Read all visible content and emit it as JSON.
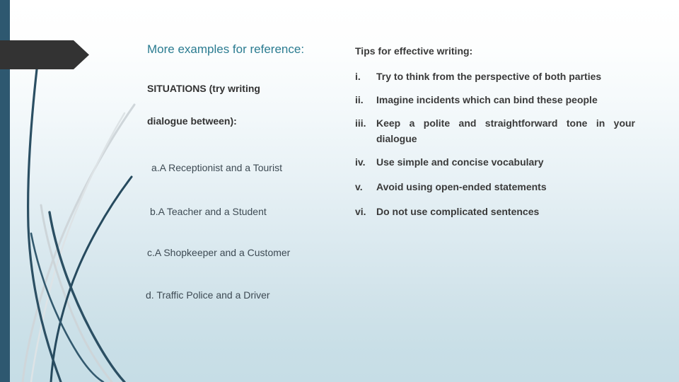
{
  "slide": {
    "background_top_color": "#ffffff",
    "background_bottom_color": "#c6dde6",
    "edge_stripe_color": "#2e5870",
    "banner_color": "#333333",
    "accent_teal": "#2b7c91",
    "body_text_color": "#3a3a3a"
  },
  "left": {
    "heading": "More examples for reference:",
    "situations_line1": "SITUATIONS (try writing",
    "situations_line2": "dialogue between):",
    "examples": [
      "a.A Receptionist and a Tourist",
      "b.A Teacher and a Student",
      "c.A Shopkeeper and a Customer",
      "d. Traffic Police and a Driver"
    ]
  },
  "right": {
    "heading": "Tips for effective writing:",
    "tips": [
      {
        "marker": "i.",
        "text": "Try to think from the perspective of both parties"
      },
      {
        "marker": "ii.",
        "text": "Imagine incidents which can bind these people"
      },
      {
        "marker": "iii.",
        "text": "Keep a polite and straightforward tone in your dialogue"
      },
      {
        "marker": "iv.",
        "text": "Use simple and concise vocabulary"
      },
      {
        "marker": "v.",
        "text": "Avoid using open-ended statements"
      },
      {
        "marker": "vi.",
        "text": "Do not use complicated sentences"
      }
    ]
  },
  "decoration": {
    "banner_shape": "right-pointing-arrow-banner",
    "strands": "curved-ribbon-lines"
  }
}
